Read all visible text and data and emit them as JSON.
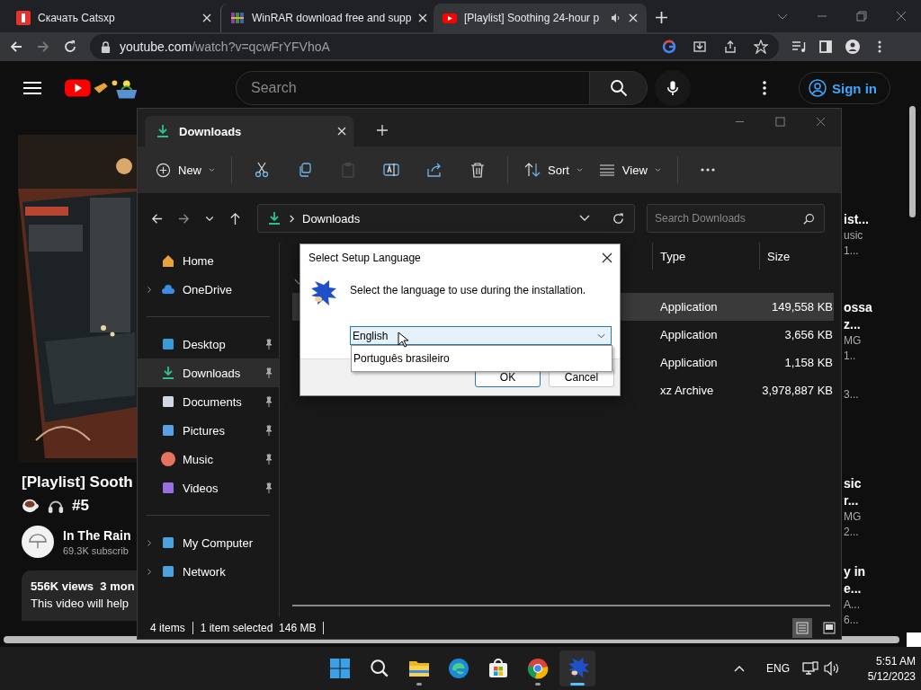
{
  "browser": {
    "tabs": [
      {
        "title": "Скачать Catsxp",
        "kind": "catsxp",
        "selected": false,
        "playing": false
      },
      {
        "title": "WinRAR download free and supp",
        "kind": "winrar",
        "selected": false,
        "playing": false
      },
      {
        "title": "[Playlist] Soothing 24-hour p",
        "kind": "youtube",
        "selected": true,
        "playing": true
      }
    ],
    "url_host": "youtube.com",
    "url_path": "/watch?v=qcwFrYFVhoA"
  },
  "youtube": {
    "search_placeholder": "Search",
    "sign_in": "Sign in",
    "video": {
      "title": "[Playlist] Sooth",
      "tag": "#5",
      "channel": "In The Rain",
      "subscribers": "69.3K subscrib",
      "views": "556K views  3 mon",
      "description": "This video will help"
    },
    "related": [
      [
        {
          "text": "ist...",
          "kind": "title"
        },
        {
          "text": "usic",
          "kind": "meta"
        },
        {
          "text": "1...",
          "kind": "meta"
        }
      ],
      [
        {
          "text": "ossa",
          "kind": "title"
        },
        {
          "text": "z...",
          "kind": "title"
        },
        {
          "text": "MG",
          "kind": "meta"
        },
        {
          "text": "1..",
          "kind": "meta"
        }
      ],
      [
        {
          "text": "3...",
          "kind": "meta"
        }
      ],
      [
        {
          "text": "sic",
          "kind": "title"
        },
        {
          "text": "r...",
          "kind": "title"
        },
        {
          "text": "MG",
          "kind": "meta"
        },
        {
          "text": "2...",
          "kind": "meta"
        }
      ],
      [
        {
          "text": "y in",
          "kind": "title"
        },
        {
          "text": "e...",
          "kind": "title"
        },
        {
          "text": "A...",
          "kind": "meta"
        },
        {
          "text": "6...",
          "kind": "meta"
        }
      ]
    ]
  },
  "explorer": {
    "tab": "Downloads",
    "toolbar": [
      {
        "kind": "new",
        "label": "New",
        "disabled": false
      },
      {
        "kind": "cut",
        "disabled": false
      },
      {
        "kind": "copy",
        "disabled": false
      },
      {
        "kind": "paste",
        "disabled": true
      },
      {
        "kind": "rename",
        "disabled": false
      },
      {
        "kind": "share",
        "disabled": false
      },
      {
        "kind": "delete",
        "disabled": false
      },
      {
        "kind": "sort",
        "label": "Sort",
        "disabled": false
      },
      {
        "kind": "view",
        "label": "View",
        "disabled": false
      },
      {
        "kind": "more",
        "disabled": false
      }
    ],
    "path": "Downloads",
    "search_placeholder": "Search Downloads",
    "nav_groups": [
      [
        {
          "label": "Home",
          "kind": "home",
          "expandable": false,
          "pinned": false,
          "selected": false
        },
        {
          "label": "OneDrive",
          "kind": "cloud",
          "expandable": true,
          "pinned": false,
          "selected": false
        }
      ],
      [
        {
          "label": "Desktop",
          "kind": "desktop",
          "expandable": false,
          "pinned": true,
          "selected": false
        },
        {
          "label": "Downloads",
          "kind": "download",
          "expandable": false,
          "pinned": true,
          "selected": true
        },
        {
          "label": "Documents",
          "kind": "document",
          "expandable": false,
          "pinned": true,
          "selected": false
        },
        {
          "label": "Pictures",
          "kind": "pictures",
          "expandable": false,
          "pinned": true,
          "selected": false
        },
        {
          "label": "Music",
          "kind": "music",
          "expandable": false,
          "pinned": true,
          "selected": false
        },
        {
          "label": "Videos",
          "kind": "videos",
          "expandable": false,
          "pinned": true,
          "selected": false
        }
      ],
      [
        {
          "label": "My Computer",
          "kind": "computer",
          "expandable": true,
          "pinned": false,
          "selected": false
        },
        {
          "label": "Network",
          "kind": "network",
          "expandable": true,
          "pinned": false,
          "selected": false
        }
      ]
    ],
    "columns": [
      "Type",
      "Size"
    ],
    "rows": [
      {
        "type": "Application",
        "size": "149,558 KB",
        "selected": true
      },
      {
        "type": "Application",
        "size": "3,656 KB",
        "selected": false
      },
      {
        "type": "Application",
        "size": "1,158 KB",
        "selected": false
      },
      {
        "type": "xz Archive",
        "size": "3,978,887 KB",
        "selected": false
      }
    ],
    "status": {
      "count": "4 items",
      "selection": "1 item selected  146 MB"
    }
  },
  "dialog": {
    "title": "Select Setup Language",
    "message": "Select the language to use during the installation.",
    "value": "English",
    "options": [
      "Português brasileiro"
    ],
    "buttons": [
      {
        "label": "OK",
        "default": true
      },
      {
        "label": "Cancel",
        "default": false
      }
    ]
  },
  "taskbar": {
    "apps": [
      {
        "kind": "start",
        "running": false,
        "active": false
      },
      {
        "kind": "search",
        "running": false,
        "active": false
      },
      {
        "kind": "folder",
        "running": true,
        "active": false
      },
      {
        "kind": "edge",
        "running": false,
        "active": false
      },
      {
        "kind": "store",
        "running": false,
        "active": false
      },
      {
        "kind": "chrome",
        "running": true,
        "active": false
      },
      {
        "kind": "setup",
        "running": true,
        "active": true
      }
    ],
    "language": "ENG",
    "time": "5:51 AM",
    "date": "5/12/2023"
  }
}
